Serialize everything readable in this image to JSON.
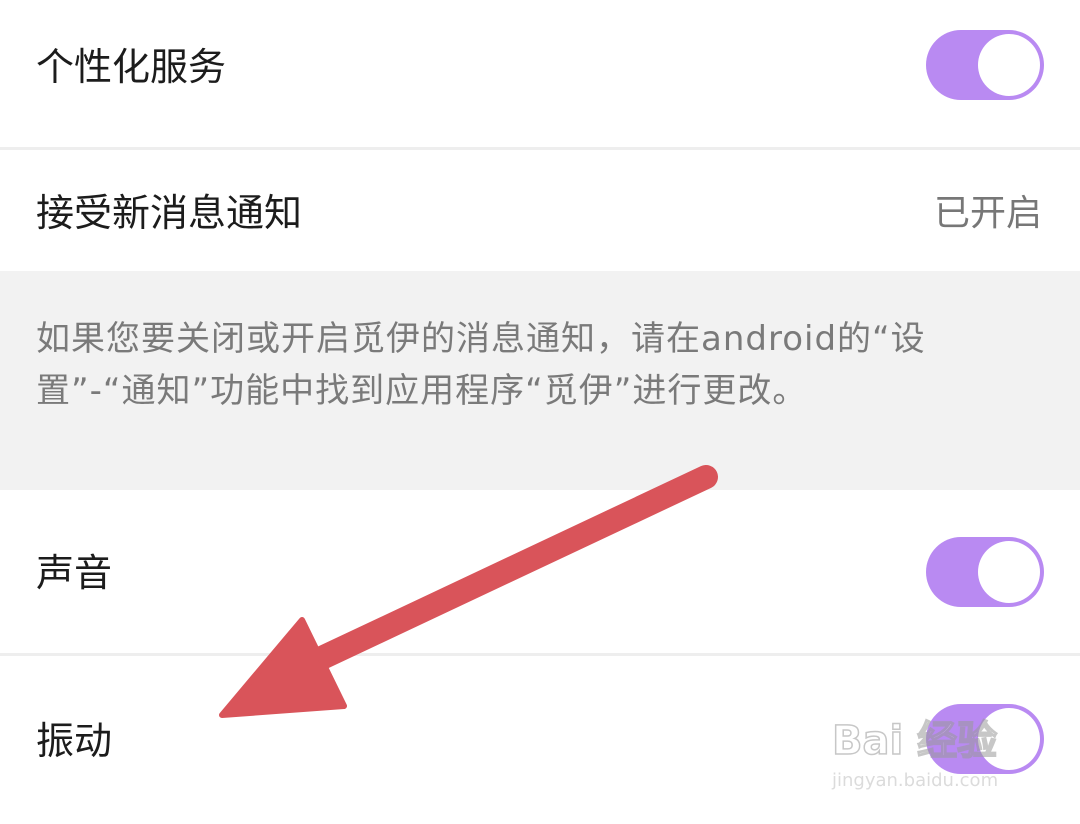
{
  "settings": {
    "personalized_service": {
      "label": "个性化服务",
      "enabled": true
    },
    "new_message_notification": {
      "label": "接受新消息通知",
      "value": "已开启"
    },
    "notification_info": "如果您要关闭或开启觅伊的消息通知，请在android的“设置”-“通知”功能中找到应用程序“觅伊”进行更改。",
    "sound": {
      "label": "声音",
      "enabled": true
    },
    "vibration": {
      "label": "振动",
      "enabled": true
    }
  },
  "colors": {
    "toggle_on": "#b98af2",
    "annotation_arrow": "#d9545a",
    "info_background": "#f2f2f2"
  },
  "watermark": {
    "brand": "Bai 经验",
    "url": "jingyan.baidu.com"
  }
}
